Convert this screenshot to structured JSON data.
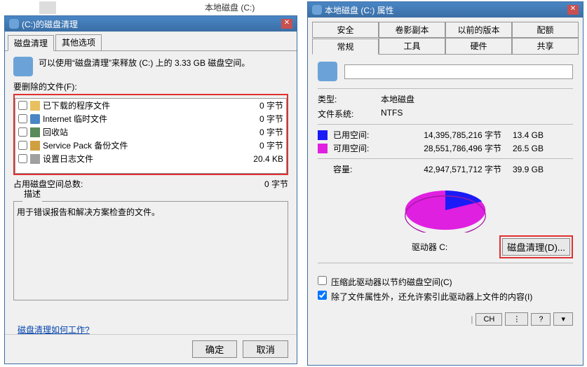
{
  "desktop": {
    "secondWindowTitle": "本地磁盘 (C:)"
  },
  "cleanup": {
    "title": "(C:)的磁盘清理",
    "tabs": {
      "cleanup": "磁盘清理",
      "more": "其他选项"
    },
    "intro": "可以使用“磁盘清理”来释放 (C:) 上的 3.33 GB 磁盘空间。",
    "filesToDeleteLabel": "要删除的文件(F):",
    "files": [
      {
        "name": "已下载的程序文件",
        "size": "0 字节"
      },
      {
        "name": "Internet 临时文件",
        "size": "0 字节"
      },
      {
        "name": "回收站",
        "size": "0 字节"
      },
      {
        "name": "Service Pack 备份文件",
        "size": "0 字节"
      },
      {
        "name": "设置日志文件",
        "size": "20.4 KB"
      }
    ],
    "totalLabel": "占用磁盘空间总数:",
    "totalSize": "0 字节",
    "descLabel": "描述",
    "descText": "用于错误报告和解决方案检查的文件。",
    "link": "磁盘清理如何工作?",
    "ok": "确定",
    "cancel": "取消"
  },
  "props": {
    "title": "本地磁盘 (C:) 属性",
    "tabsTop": {
      "security": "安全",
      "shadow": "卷影副本",
      "previous": "以前的版本",
      "quota": "配额"
    },
    "tabsBottom": {
      "general": "常规",
      "tools": "工具",
      "hardware": "硬件",
      "sharing": "共享"
    },
    "volumeLabel": "",
    "typeLabel": "类型:",
    "typeValue": "本地磁盘",
    "fsLabel": "文件系统:",
    "fsValue": "NTFS",
    "usedLabel": "已用空间:",
    "usedBytes": "14,395,785,216 字节",
    "usedGB": "13.4 GB",
    "freeLabel": "可用空间:",
    "freeBytes": "28,551,786,496 字节",
    "freeGB": "26.5 GB",
    "capLabel": "容量:",
    "capBytes": "42,947,571,712 字节",
    "capGB": "39.9 GB",
    "driveName": "驱动器 C:",
    "cleanupBtn": "磁盘清理(D)...",
    "compress": "压缩此驱动器以节约磁盘空间(C)",
    "index": "除了文件属性外，还允许索引此驱动器上文件的内容(I)",
    "chBtn": "CH",
    "dottedBtn": "⋮",
    "helpBtn": "?",
    "chevBtn": "▾"
  },
  "chart_data": {
    "type": "pie",
    "title": "驱动器 C:",
    "series": [
      {
        "name": "已用空间",
        "value": 14395785216,
        "color": "#1b1bf7"
      },
      {
        "name": "可用空间",
        "value": 28551786496,
        "color": "#e020e0"
      }
    ]
  }
}
